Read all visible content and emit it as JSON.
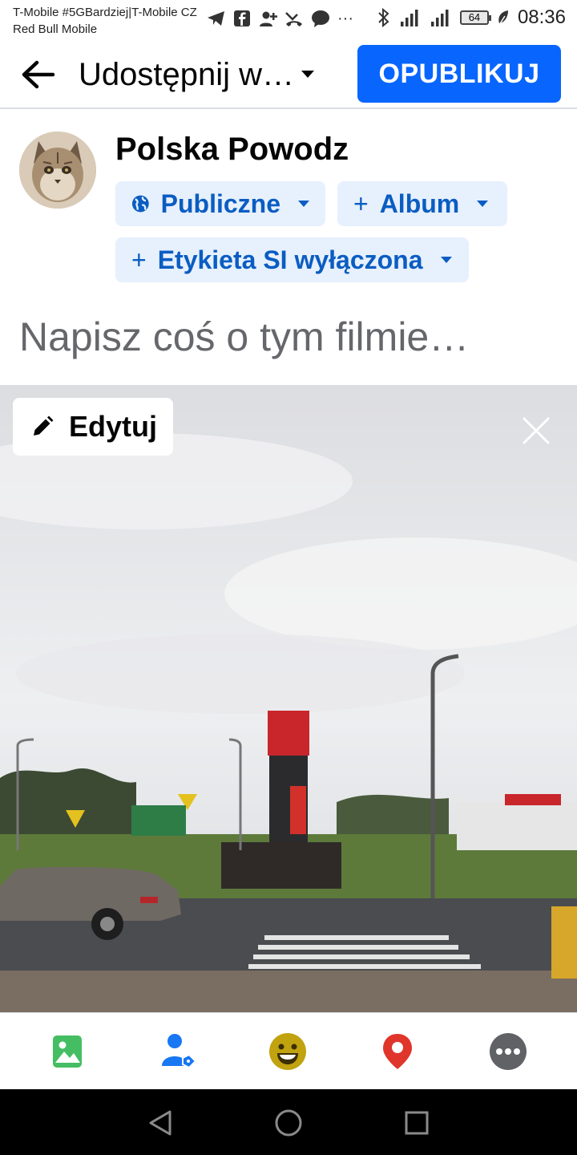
{
  "status_bar": {
    "carrier_line1": "T-Mobile #5GBardziej|T-Mobile CZ",
    "carrier_line2": "Red Bull Mobile",
    "battery": "64",
    "time": "08:36"
  },
  "header": {
    "title": "Udostępnij w…",
    "publish_label": "OPUBLIKUJ",
    "accent_color": "#0866ff"
  },
  "author": {
    "name": "Polska Powodz"
  },
  "chips": {
    "audience": "Publiczne",
    "album": "Album",
    "ai_label": "Etykieta SI wyłączona"
  },
  "composer": {
    "placeholder": "Napisz coś o tym filmie…"
  },
  "video": {
    "edit_label": "Edytuj"
  },
  "toolbar": {
    "icons": [
      "photo-icon",
      "tag-people-icon",
      "feeling-icon",
      "location-icon",
      "more-icon"
    ]
  },
  "nav": {
    "icons": [
      "back-triangle-icon",
      "home-circle-icon",
      "recents-square-icon"
    ]
  }
}
